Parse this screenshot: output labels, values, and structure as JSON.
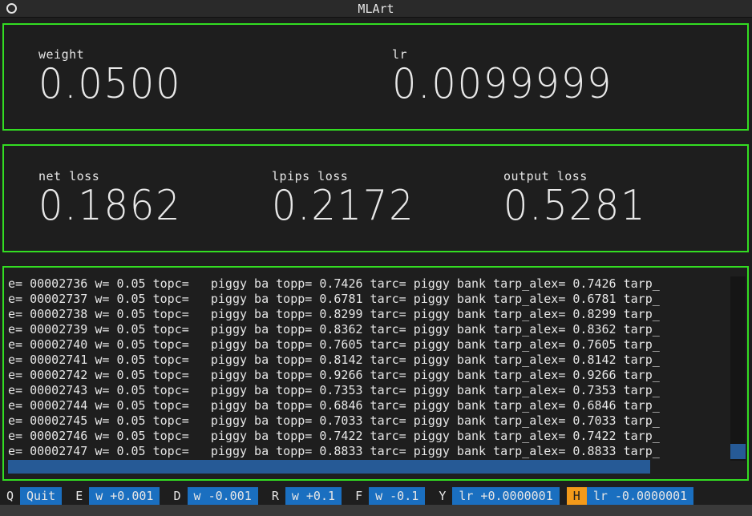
{
  "window": {
    "title": "MLArt"
  },
  "params": {
    "weight": {
      "label": "weight",
      "value": "0.0500"
    },
    "lr": {
      "label": "lr",
      "value": "0.0099999"
    }
  },
  "losses": {
    "net": {
      "label": "net loss",
      "value": "0.1862"
    },
    "lpips": {
      "label": "lpips loss",
      "value": "0.2172"
    },
    "output": {
      "label": "output loss",
      "value": "0.5281"
    }
  },
  "log": {
    "lines": [
      "e= 00002736 w= 0.05 topc=   piggy ba topp= 0.7426 tarc= piggy bank tarp_alex= 0.7426 tarp_",
      "e= 00002737 w= 0.05 topc=   piggy ba topp= 0.6781 tarc= piggy bank tarp_alex= 0.6781 tarp_",
      "e= 00002738 w= 0.05 topc=   piggy ba topp= 0.8299 tarc= piggy bank tarp_alex= 0.8299 tarp_",
      "e= 00002739 w= 0.05 topc=   piggy ba topp= 0.8362 tarc= piggy bank tarp_alex= 0.8362 tarp_",
      "e= 00002740 w= 0.05 topc=   piggy ba topp= 0.7605 tarc= piggy bank tarp_alex= 0.7605 tarp_",
      "e= 00002741 w= 0.05 topc=   piggy ba topp= 0.8142 tarc= piggy bank tarp_alex= 0.8142 tarp_",
      "e= 00002742 w= 0.05 topc=   piggy ba topp= 0.9266 tarc= piggy bank tarp_alex= 0.9266 tarp_",
      "e= 00002743 w= 0.05 topc=   piggy ba topp= 0.7353 tarc= piggy bank tarp_alex= 0.7353 tarp_",
      "e= 00002744 w= 0.05 topc=   piggy ba topp= 0.6846 tarc= piggy bank tarp_alex= 0.6846 tarp_",
      "e= 00002745 w= 0.05 topc=   piggy ba topp= 0.7033 tarc= piggy bank tarp_alex= 0.7033 tarp_",
      "e= 00002746 w= 0.05 topc=   piggy ba topp= 0.7422 tarc= piggy bank tarp_alex= 0.7422 tarp_",
      "e= 00002747 w= 0.05 topc=   piggy ba topp= 0.8833 tarc= piggy bank tarp_alex= 0.8833 tarp_"
    ]
  },
  "footer": {
    "bindings": [
      {
        "key": "Q",
        "action": "Quit"
      },
      {
        "key": "E",
        "action": "w +0.001"
      },
      {
        "key": "D",
        "action": "w -0.001"
      },
      {
        "key": "R",
        "action": "w +0.1"
      },
      {
        "key": "F",
        "action": "w -0.1"
      },
      {
        "key": "Y",
        "action": "lr +0.0000001"
      },
      {
        "key": "H",
        "action": "lr -0.0000001",
        "highlight": true
      }
    ]
  },
  "colors": {
    "panel_border": "#33dd22",
    "background": "#1e1e1e",
    "action_bg": "#1a6fc0",
    "key_highlight": "#f39a1a",
    "scroll_thumb": "#265a96"
  }
}
